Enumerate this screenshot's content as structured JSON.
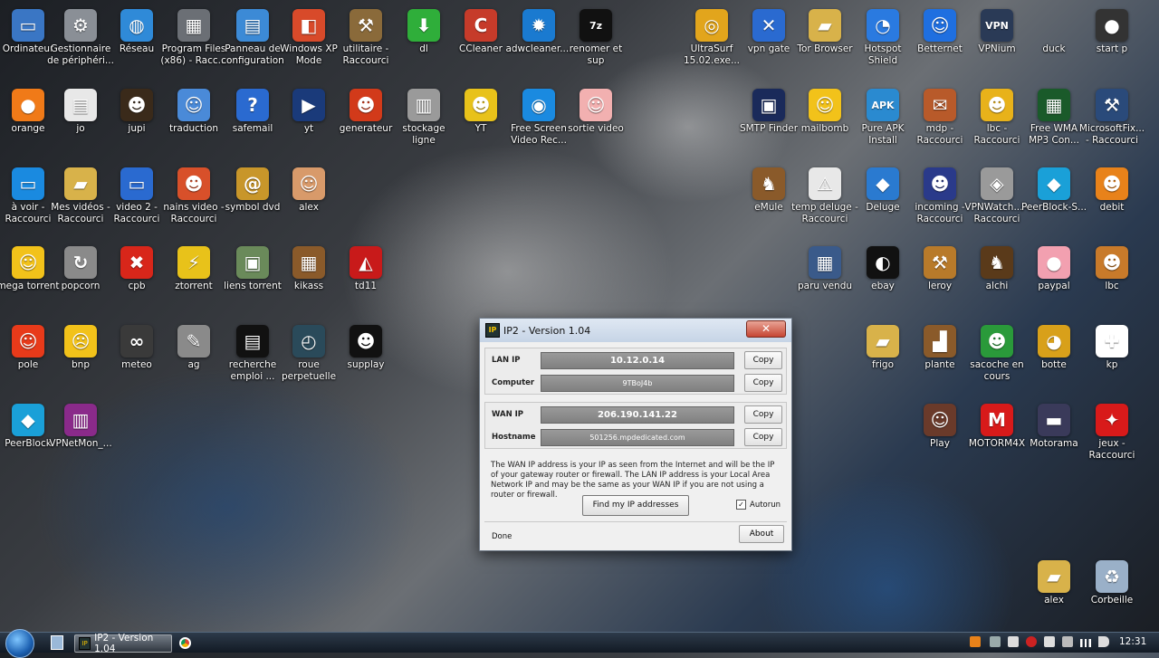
{
  "desktop_icons": [
    {
      "label": "Ordinateur",
      "icon": "computer-icon",
      "color": "#3a76c4",
      "glyph": "▭"
    },
    {
      "label": "Gestionnaire de périphéri...",
      "icon": "device-manager-icon",
      "color": "#8a8f96",
      "glyph": "⚙"
    },
    {
      "label": "Réseau",
      "icon": "network-globe-icon",
      "color": "#2f8ad8",
      "glyph": "◍"
    },
    {
      "label": "Program Files (x86) - Racc...",
      "icon": "program-files-icon",
      "color": "#6b6f75",
      "glyph": "▦"
    },
    {
      "label": "Panneau de configuration",
      "icon": "control-panel-icon",
      "color": "#3c8ad6",
      "glyph": "▤"
    },
    {
      "label": "Windows XP Mode",
      "icon": "windows-xp-icon",
      "color": "#d84a2a",
      "glyph": "◧"
    },
    {
      "label": "utilitaire - Raccourci",
      "icon": "hammer-icon",
      "color": "#8a6a3a",
      "glyph": "⚒"
    },
    {
      "label": "dl",
      "icon": "download-arrow-icon",
      "color": "#2fae3a",
      "glyph": "⬇"
    },
    {
      "label": "CCleaner",
      "icon": "ccleaner-icon",
      "color": "#c63b2a",
      "glyph": "C"
    },
    {
      "label": "adwcleaner....",
      "icon": "adwcleaner-icon",
      "color": "#1a7ad0",
      "glyph": "✹"
    },
    {
      "label": "renomer et sup",
      "icon": "7zip-icon",
      "color": "#111111",
      "glyph": "7z"
    },
    {
      "label": "",
      "icon": "blank",
      "color": "transparent",
      "glyph": ""
    },
    {
      "label": "UltraSurf 15.02.exe...",
      "icon": "ultrasurf-icon",
      "color": "#e2a51c",
      "glyph": "◎"
    },
    {
      "label": "vpn gate",
      "icon": "vpn-gate-icon",
      "color": "#2a6ad0",
      "glyph": "✕"
    },
    {
      "label": "Tor Browser",
      "icon": "folder-icon",
      "color": "#d8b24a",
      "glyph": "▰"
    },
    {
      "label": "Hotspot Shield",
      "icon": "hotspot-shield-icon",
      "color": "#2a7ae0",
      "glyph": "◔"
    },
    {
      "label": "Betternet",
      "icon": "betternet-icon",
      "color": "#1f6fe0",
      "glyph": "☺"
    },
    {
      "label": "VPNium",
      "icon": "vpnium-icon",
      "color": "#2a3a56",
      "glyph": "VPN"
    },
    {
      "label": "duck",
      "icon": "shortcut-icon",
      "color": "transparent",
      "glyph": ""
    },
    {
      "label": "start p",
      "icon": "traffic-light-icon",
      "color": "#333333",
      "glyph": "●"
    },
    {
      "label": "orange",
      "icon": "orange-icon",
      "color": "#f07a18",
      "glyph": "●"
    },
    {
      "label": "jo",
      "icon": "newspaper-icon",
      "color": "#e8e8e8",
      "glyph": "▤"
    },
    {
      "label": "jupi",
      "icon": "man-avatar-icon",
      "color": "#3a2a1a",
      "glyph": "☻"
    },
    {
      "label": "traduction",
      "icon": "finder-icon",
      "color": "#4a8ad8",
      "glyph": "☺"
    },
    {
      "label": "safemail",
      "icon": "help-icon",
      "color": "#2a6ad0",
      "glyph": "?"
    },
    {
      "label": "yt",
      "icon": "video-clapper-icon",
      "color": "#1a3a7a",
      "glyph": "▶"
    },
    {
      "label": "generateur",
      "icon": "devil-icon",
      "color": "#d23a1a",
      "glyph": "☻"
    },
    {
      "label": "stockage ligne",
      "icon": "database-icon",
      "color": "#9a9a9a",
      "glyph": "▥"
    },
    {
      "label": "YT",
      "icon": "cartoon-icon",
      "color": "#e8c21a",
      "glyph": "☻"
    },
    {
      "label": "Free Screen Video Rec...",
      "icon": "screen-recorder-icon",
      "color": "#1a8ae0",
      "glyph": "◉"
    },
    {
      "label": "sortie video",
      "icon": "face-icon",
      "color": "#f2b0b0",
      "glyph": "☺"
    },
    {
      "label": "",
      "icon": "blank",
      "color": "transparent",
      "glyph": ""
    },
    {
      "label": "SMTP Finder",
      "icon": "smtp-finder-icon",
      "color": "#1a2a5a",
      "glyph": "▣"
    },
    {
      "label": "mailbomb",
      "icon": "smiley-glasses-icon",
      "color": "#f2c21a",
      "glyph": "☺"
    },
    {
      "label": "Pure APK Install",
      "icon": "apk-icon",
      "color": "#2a8ad0",
      "glyph": "APK"
    },
    {
      "label": "mdp - Raccourci",
      "icon": "mailbox-icon",
      "color": "#b85a2a",
      "glyph": "✉"
    },
    {
      "label": "lbc - Raccourci",
      "icon": "cartoon-dog-icon",
      "color": "#e8b21a",
      "glyph": "☻"
    },
    {
      "label": "Free WMA MP3 Con...",
      "icon": "converter-icon",
      "color": "#1a5a2a",
      "glyph": "▦"
    },
    {
      "label": "MicrosoftFix... - Raccourci",
      "icon": "repair-man-icon",
      "color": "#2a4a7a",
      "glyph": "⚒"
    },
    {
      "label": "à voir - Raccourci",
      "icon": "monitor-icon",
      "color": "#1a8ae0",
      "glyph": "▭"
    },
    {
      "label": "Mes vidéos - Raccourci",
      "icon": "videos-folder-icon",
      "color": "#d8b24a",
      "glyph": "▰"
    },
    {
      "label": "video 2 - Raccourci",
      "icon": "computer-network-icon",
      "color": "#2a6ad0",
      "glyph": "▭"
    },
    {
      "label": "nains video - Raccourci",
      "icon": "dwarfs-icon",
      "color": "#d8502a",
      "glyph": "☻"
    },
    {
      "label": "symbol dvd",
      "icon": "address-book-icon",
      "color": "#c8962a",
      "glyph": "@"
    },
    {
      "label": "alex",
      "icon": "person-icon",
      "color": "#d89a6a",
      "glyph": "☺"
    },
    {
      "label": "",
      "icon": "blank",
      "color": "transparent",
      "glyph": ""
    },
    {
      "label": "eMule",
      "icon": "emule-icon",
      "color": "#8a5a2a",
      "glyph": "♞"
    },
    {
      "label": "temp deluge - Raccourci",
      "icon": "warning-icon",
      "color": "#e8e8e8",
      "glyph": "⚠"
    },
    {
      "label": "Deluge",
      "icon": "deluge-icon",
      "color": "#2a7ad0",
      "glyph": "◆"
    },
    {
      "label": "incoming - Raccourci",
      "icon": "policeman-icon",
      "color": "#2a3a8a",
      "glyph": "☻"
    },
    {
      "label": "VPNWatch... - Raccourci",
      "icon": "car-logo-icon",
      "color": "#9a9a9a",
      "glyph": "◈"
    },
    {
      "label": "PeerBlock-S...",
      "icon": "peerblock-icon",
      "color": "#1aa0d8",
      "glyph": "◆"
    },
    {
      "label": "debit",
      "icon": "cartoon-character-icon",
      "color": "#e8821a",
      "glyph": "☻"
    },
    {
      "label": "mega torrent",
      "icon": "cool-smiley-icon",
      "color": "#f2c21a",
      "glyph": "☺"
    },
    {
      "label": "popcorn",
      "icon": "refresh-icon",
      "color": "#8a8a8a",
      "glyph": "↻"
    },
    {
      "label": "cpb",
      "icon": "red-cross-icon",
      "color": "#d8261a",
      "glyph": "✖"
    },
    {
      "label": "ztorrent",
      "icon": "lightning-icon",
      "color": "#e8c21a",
      "glyph": "⚡"
    },
    {
      "label": "liens torrent",
      "icon": "window-icon",
      "color": "#6a8a5a",
      "glyph": "▣"
    },
    {
      "label": "kikass",
      "icon": "abacus-icon",
      "color": "#8a5a2a",
      "glyph": "▦"
    },
    {
      "label": "td11",
      "icon": "acrobat-icon",
      "color": "#c81a1a",
      "glyph": "◭"
    },
    {
      "label": "paru vendu",
      "icon": "flowchart-icon",
      "color": "#3a5a8a",
      "glyph": "▦"
    },
    {
      "label": "ebay",
      "icon": "penguin-icon",
      "color": "#111111",
      "glyph": "◐"
    },
    {
      "label": "leroy",
      "icon": "hammer-tool-icon",
      "color": "#b87a2a",
      "glyph": "⚒"
    },
    {
      "label": "alchi",
      "icon": "chess-icon",
      "color": "#5a3a1a",
      "glyph": "♞"
    },
    {
      "label": "paypal",
      "icon": "piggy-bank-icon",
      "color": "#f2a0b0",
      "glyph": "●"
    },
    {
      "label": "lbc",
      "icon": "character-icon",
      "color": "#c87a2a",
      "glyph": "☻"
    },
    {
      "label": "pole",
      "icon": "smiley-icon",
      "color": "#e83a1a",
      "glyph": "☺"
    },
    {
      "label": "bnp",
      "icon": "sad-smiley-icon",
      "color": "#f2c21a",
      "glyph": "☹"
    },
    {
      "label": "meteo",
      "icon": "binoculars-icon",
      "color": "#3a3a3a",
      "glyph": "∞"
    },
    {
      "label": "ag",
      "icon": "pen-icon",
      "color": "#8a8a8a",
      "glyph": "✎"
    },
    {
      "label": "recherche emploi ...",
      "icon": "terminal-warning-icon",
      "color": "#111111",
      "glyph": "▤"
    },
    {
      "label": "roue perpetuelle",
      "icon": "time-machine-icon",
      "color": "#2a4a5a",
      "glyph": "◴"
    },
    {
      "label": "supplay",
      "icon": "penguin-cartoon-icon",
      "color": "#111111",
      "glyph": "☻"
    },
    {
      "label": "frigo",
      "icon": "folder-icon",
      "color": "#d8b24a",
      "glyph": "▰"
    },
    {
      "label": "plante",
      "icon": "boot-icon",
      "color": "#8a5a2a",
      "glyph": "▟"
    },
    {
      "label": "sacoche en cours",
      "icon": "shy-guy-icon",
      "color": "#2a9a3a",
      "glyph": "☻"
    },
    {
      "label": "botte",
      "icon": "helmet-icon",
      "color": "#d8a01a",
      "glyph": "◕"
    },
    {
      "label": "kp",
      "icon": "first-aid-icon",
      "color": "#ffffff",
      "glyph": "✚"
    },
    {
      "label": "PeerBlock",
      "icon": "peerblock-icon",
      "color": "#1aa0d8",
      "glyph": "◆"
    },
    {
      "label": "VPNetMon_...",
      "icon": "winrar-icon",
      "color": "#8a2a8a",
      "glyph": "▥"
    },
    {
      "label": "Play",
      "icon": "photo-icon",
      "color": "#6a3a2a",
      "glyph": "☺"
    },
    {
      "label": "MOTORM4X",
      "icon": "motorm4x-icon",
      "color": "#d81a1a",
      "glyph": "M"
    },
    {
      "label": "Motorama",
      "icon": "car-icon",
      "color": "#3a3a5a",
      "glyph": "▬"
    },
    {
      "label": "jeux - Raccourci",
      "icon": "joystick-icon",
      "color": "#d81a1a",
      "glyph": "✦"
    },
    {
      "label": "alex",
      "icon": "folder-icon",
      "color": "#d8b24a",
      "glyph": "▰"
    },
    {
      "label": "Corbeille",
      "icon": "recycle-bin-icon",
      "color": "#9ab0c8",
      "glyph": "♻"
    }
  ],
  "window": {
    "title": "IP2 - Version 1.04",
    "app_icon": "IP",
    "close_glyph": "✕",
    "lan_ip_label": "LAN IP",
    "lan_ip_value": "10.12.0.14",
    "computer_label": "Computer",
    "computer_value": "9TBoJ4b",
    "wan_ip_label": "WAN IP",
    "wan_ip_value": "206.190.141.22",
    "hostname_label": "Hostname",
    "hostname_value": "501256.mpdedicated.com",
    "copy_label": "Copy",
    "description": "The WAN IP address is your IP as seen from the Internet and will be the IP of your gateway router or firewall. The LAN IP address is your Local Area Network IP and may be the same as your WAN IP if you are not using a router or firewall.",
    "find_button": "Find my IP addresses",
    "autorun_label": "Autorun",
    "autorun_checked": true,
    "status": "Done",
    "about_button": "About"
  },
  "taskbar": {
    "active_window": "IP2 - Version 1.04",
    "clock": "12:31"
  }
}
